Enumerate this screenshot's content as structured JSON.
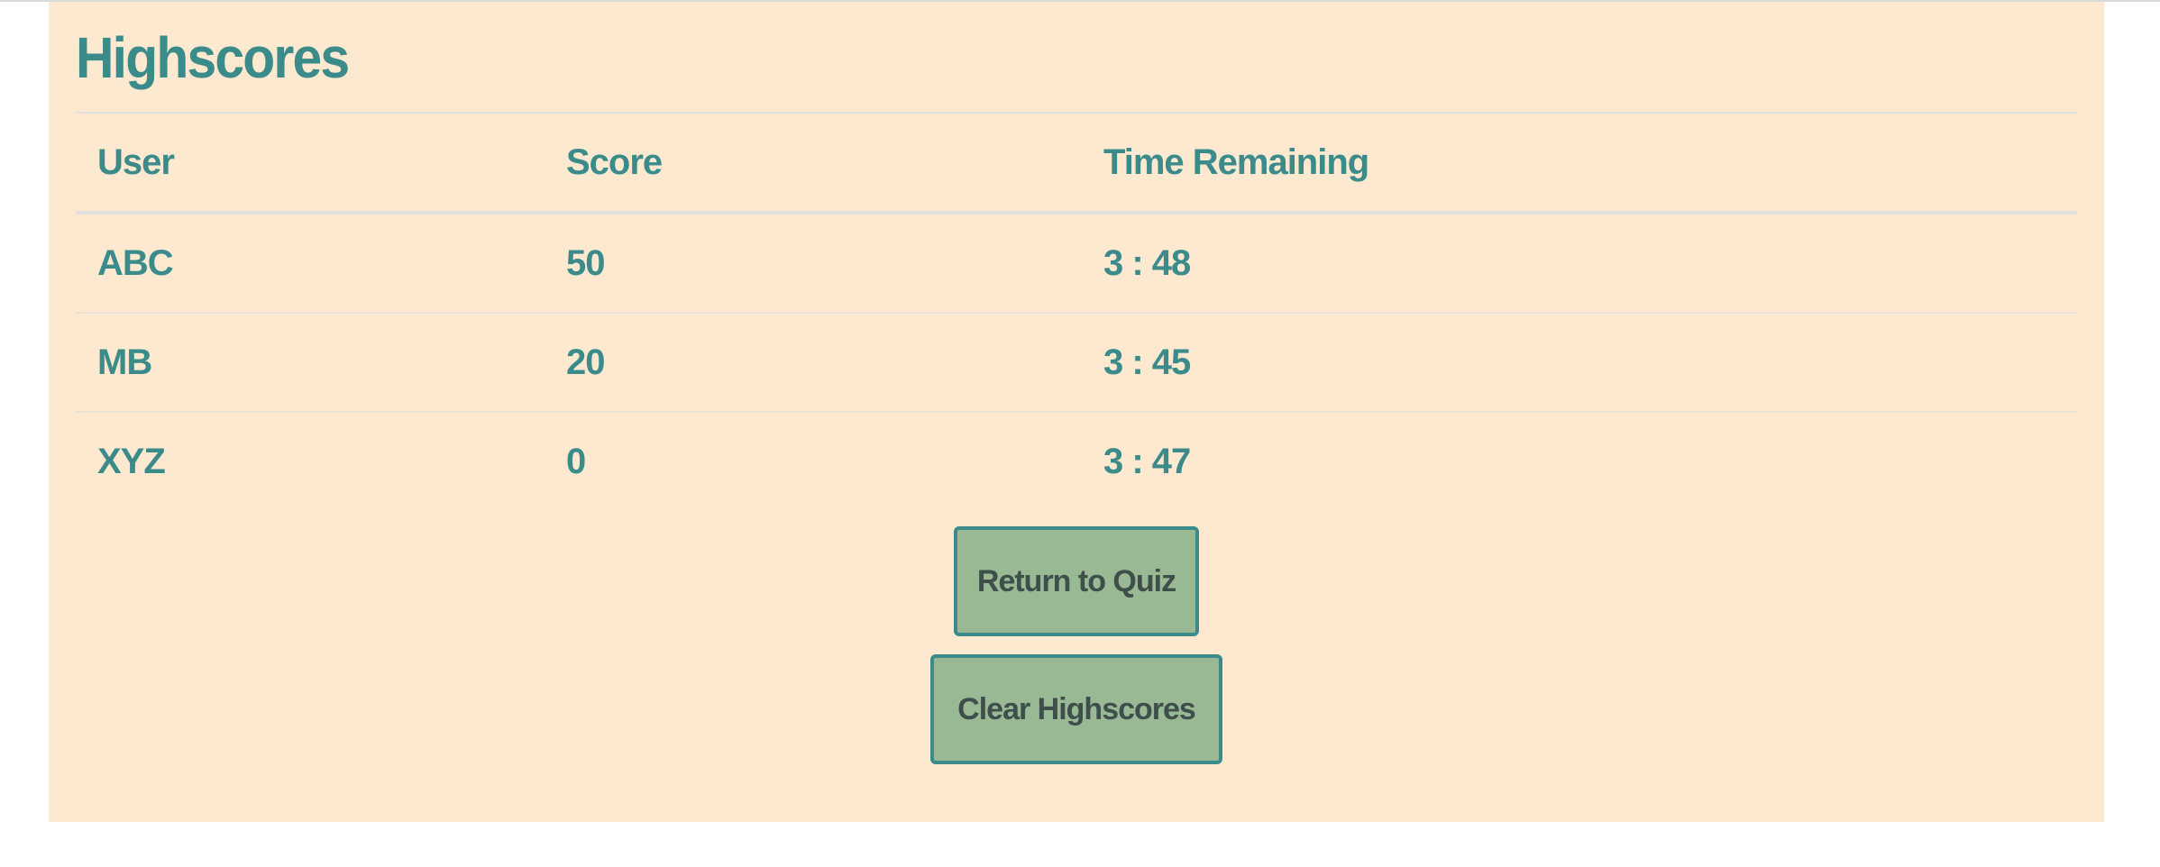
{
  "page": {
    "title": "Highscores"
  },
  "table": {
    "headers": {
      "user": "User",
      "score": "Score",
      "time": "Time Remaining"
    },
    "rows": [
      {
        "user": "ABC",
        "score": "50",
        "time": "3 : 48"
      },
      {
        "user": "MB",
        "score": "20",
        "time": "3 : 45"
      },
      {
        "user": "XYZ",
        "score": "0",
        "time": "3 : 47"
      }
    ]
  },
  "actions": {
    "return_label": "Return to Quiz",
    "clear_label": "Clear Highscores"
  },
  "colors": {
    "panel_background": "#fce9d0",
    "accent_teal": "#3b8b8b",
    "button_fill": "#99b994",
    "button_text": "#3e4e4a"
  }
}
